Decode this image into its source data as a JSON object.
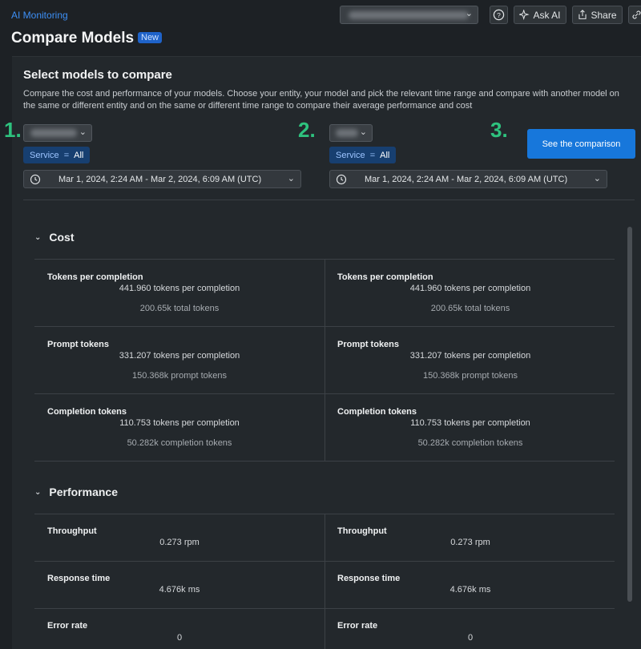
{
  "header": {
    "breadcrumb": "AI Monitoring",
    "title": "Compare Models",
    "new_badge": "New",
    "ask_ai": "Ask AI",
    "share": "Share"
  },
  "selector": {
    "title": "Select models to compare",
    "description": "Compare the cost and performance of your models. Choose your entity, your model and pick the relevant time range and compare with another model on the same or different entity and on the same or different time range to compare their average performance and cost",
    "step1": "1.",
    "step2": "2.",
    "step3": "3.",
    "left": {
      "service_label": "Service",
      "service_op": "=",
      "service_value": "All",
      "time_range": "Mar 1, 2024, 2:24 AM - Mar 2, 2024, 6:09 AM (UTC)"
    },
    "right": {
      "service_label": "Service",
      "service_op": "=",
      "service_value": "All",
      "time_range": "Mar 1, 2024, 2:24 AM - Mar 2, 2024, 6:09 AM (UTC)"
    },
    "compare_button": "See the comparison"
  },
  "cost": {
    "title": "Cost",
    "rows": [
      {
        "title": "Tokens per completion",
        "left_main": "441.960 tokens per completion",
        "left_sub": "200.65k total tokens",
        "right_main": "441.960 tokens per completion",
        "right_sub": "200.65k total tokens"
      },
      {
        "title": "Prompt tokens",
        "left_main": "331.207 tokens per completion",
        "left_sub": "150.368k prompt tokens",
        "right_main": "331.207 tokens per completion",
        "right_sub": "150.368k prompt tokens"
      },
      {
        "title": "Completion tokens",
        "left_main": "110.753 tokens per completion",
        "left_sub": "50.282k completion tokens",
        "right_main": "110.753 tokens per completion",
        "right_sub": "50.282k completion tokens"
      }
    ]
  },
  "performance": {
    "title": "Performance",
    "rows": [
      {
        "title": "Throughput",
        "left_main": "0.273 rpm",
        "right_main": "0.273 rpm"
      },
      {
        "title": "Response time",
        "left_main": "4.676k ms",
        "right_main": "4.676k ms"
      },
      {
        "title": "Error rate",
        "left_main": "0",
        "right_main": "0"
      }
    ]
  },
  "colors": {
    "accent": "#1777db",
    "step": "#2ec27e",
    "link": "#3d8ff5"
  }
}
